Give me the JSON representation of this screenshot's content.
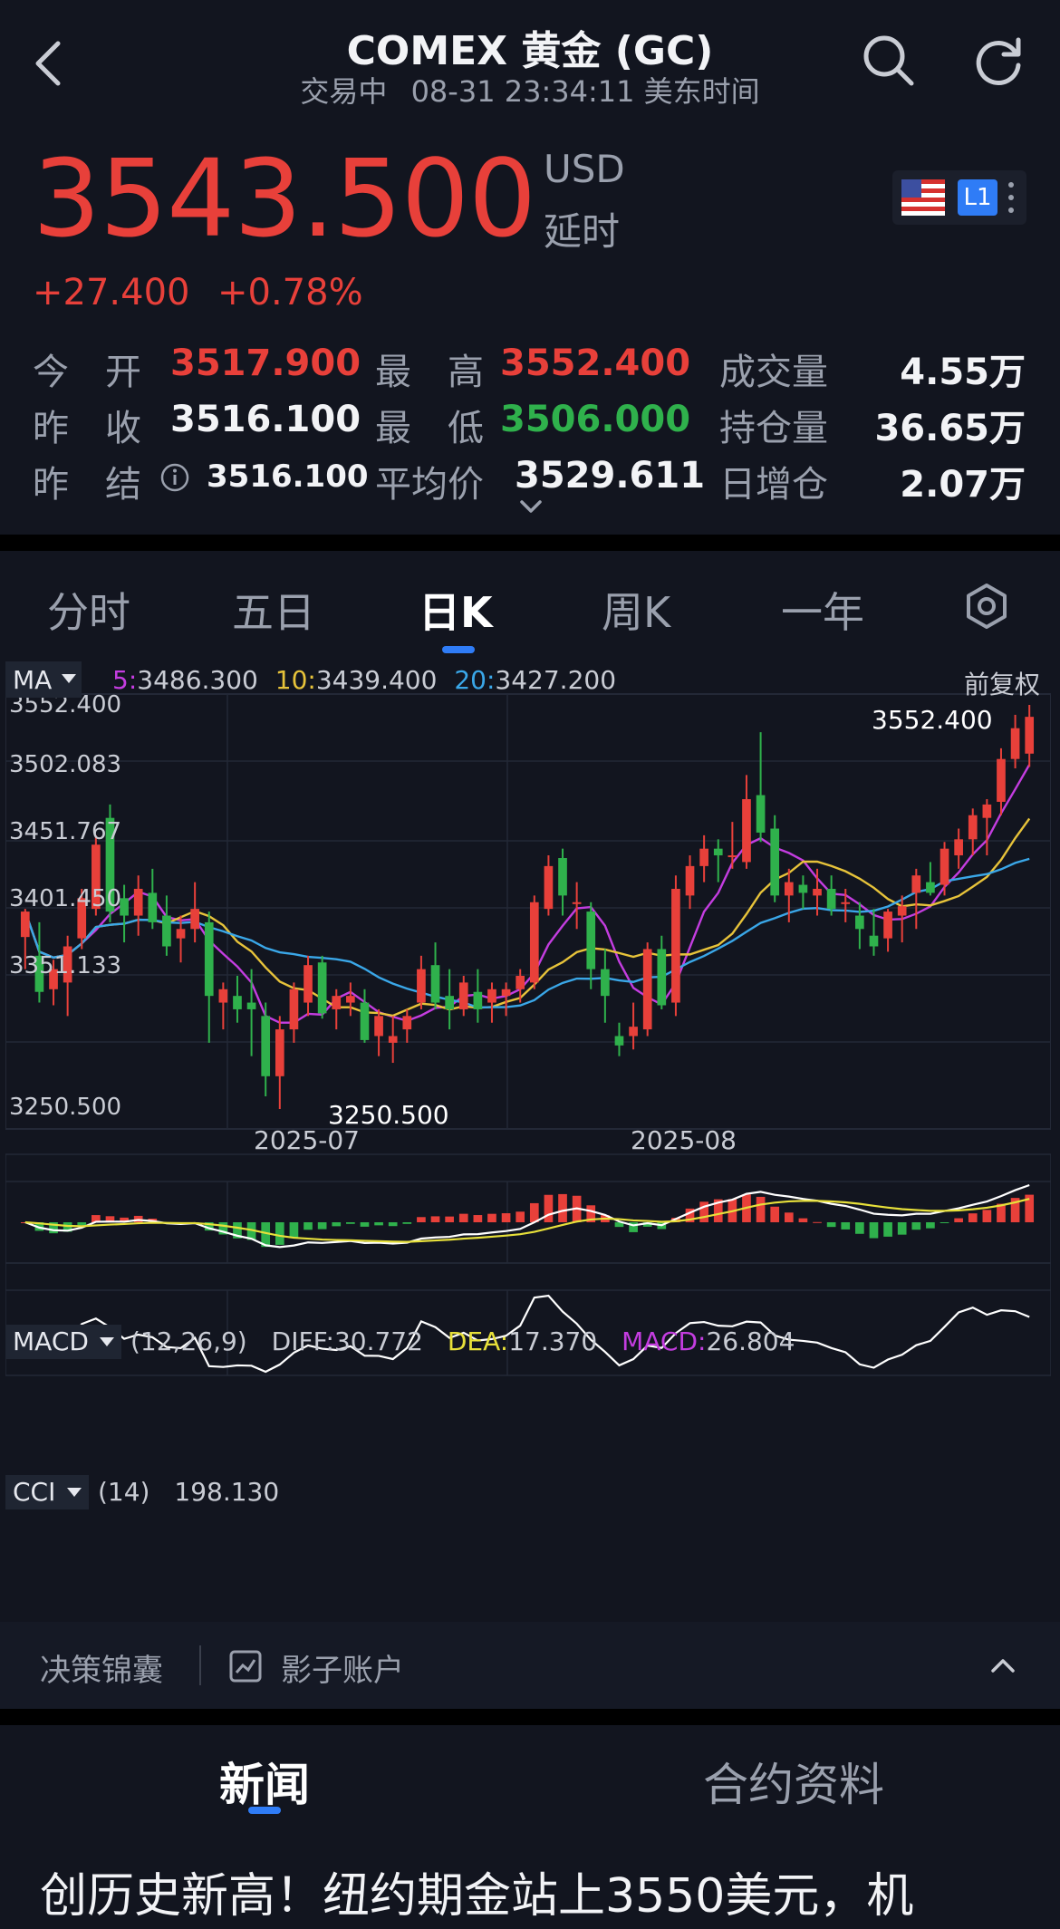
{
  "header": {
    "title": "COMEX 黄金 (GC)",
    "status": "交易中",
    "timestamp": "08-31 23:34:11 美东时间"
  },
  "quote": {
    "price": "3543.500",
    "currency": "USD",
    "delay": "延时",
    "change": "+27.400",
    "change_pct": "+0.78%",
    "level_badge": "L1",
    "up_color": "#e8403a",
    "down_color": "#2fb14c"
  },
  "stats": {
    "open_label": "今　开",
    "open": "3517.900",
    "high_label": "最　高",
    "high": "3552.400",
    "volume_label": "成交量",
    "volume": "4.55万",
    "prev_close_label": "昨　收",
    "prev_close": "3516.100",
    "low_label": "最　低",
    "low": "3506.000",
    "oi_label": "持仓量",
    "oi": "36.65万",
    "prev_settle_label": "昨　结",
    "prev_settle": "3516.100",
    "avg_label": "平均价",
    "avg": "3529.611",
    "oi_chg_label": "日增仓",
    "oi_chg": "2.07万"
  },
  "tabs": [
    "分时",
    "五日",
    "日K",
    "周K",
    "一年"
  ],
  "active_tab": "日K",
  "indicators": {
    "ma_btn": "MA",
    "ma5_key": "5:",
    "ma5": "3486.300",
    "ma10_key": "10:",
    "ma10": "3439.400",
    "ma20_key": "20:",
    "ma20": "3427.200",
    "adjust": "前复权",
    "macd_btn": "MACD",
    "macd_params": "(12,26,9)",
    "diff_key": "DIFF:",
    "diff": "30.772",
    "dea_key": "DEA:",
    "dea": "17.370",
    "macd_key": "MACD:",
    "macd": "26.804",
    "cci_btn": "CCI",
    "cci_params": "(14)",
    "cci": "198.130"
  },
  "chart_data": {
    "type": "candlestick",
    "y_axis_ticks": [
      "3552.400",
      "3502.083",
      "3451.767",
      "3401.450",
      "3351.133",
      "3250.500"
    ],
    "x_axis_ticks": [
      "2025-07",
      "2025-08"
    ],
    "ylim": [
      3250.5,
      3552.4
    ],
    "annotations": {
      "max_label": "3552.400",
      "min_label": "3250.500"
    },
    "candles": [
      {
        "o": 3379,
        "h": 3400,
        "l": 3355,
        "c": 3398
      },
      {
        "o": 3365,
        "h": 3390,
        "l": 3330,
        "c": 3338
      },
      {
        "o": 3340,
        "h": 3362,
        "l": 3328,
        "c": 3355
      },
      {
        "o": 3345,
        "h": 3380,
        "l": 3320,
        "c": 3372
      },
      {
        "o": 3378,
        "h": 3415,
        "l": 3370,
        "c": 3408
      },
      {
        "o": 3400,
        "h": 3455,
        "l": 3395,
        "c": 3448
      },
      {
        "o": 3468,
        "h": 3478,
        "l": 3390,
        "c": 3398
      },
      {
        "o": 3408,
        "h": 3418,
        "l": 3375,
        "c": 3395
      },
      {
        "o": 3395,
        "h": 3425,
        "l": 3380,
        "c": 3415
      },
      {
        "o": 3412,
        "h": 3430,
        "l": 3385,
        "c": 3390
      },
      {
        "o": 3395,
        "h": 3410,
        "l": 3365,
        "c": 3372
      },
      {
        "o": 3378,
        "h": 3395,
        "l": 3360,
        "c": 3385
      },
      {
        "o": 3385,
        "h": 3420,
        "l": 3375,
        "c": 3400
      },
      {
        "o": 3390,
        "h": 3398,
        "l": 3300,
        "c": 3335
      },
      {
        "o": 3330,
        "h": 3345,
        "l": 3310,
        "c": 3340
      },
      {
        "o": 3335,
        "h": 3350,
        "l": 3315,
        "c": 3325
      },
      {
        "o": 3330,
        "h": 3355,
        "l": 3290,
        "c": 3325
      },
      {
        "o": 3320,
        "h": 3330,
        "l": 3260,
        "c": 3275
      },
      {
        "o": 3275,
        "h": 3320,
        "l": 3250.5,
        "c": 3310
      },
      {
        "o": 3310,
        "h": 3345,
        "l": 3300,
        "c": 3340
      },
      {
        "o": 3330,
        "h": 3365,
        "l": 3320,
        "c": 3358
      },
      {
        "o": 3360,
        "h": 3365,
        "l": 3318,
        "c": 3322
      },
      {
        "o": 3325,
        "h": 3340,
        "l": 3310,
        "c": 3335
      },
      {
        "o": 3330,
        "h": 3345,
        "l": 3320,
        "c": 3335
      },
      {
        "o": 3330,
        "h": 3340,
        "l": 3300,
        "c": 3302
      },
      {
        "o": 3305,
        "h": 3325,
        "l": 3290,
        "c": 3320
      },
      {
        "o": 3300,
        "h": 3320,
        "l": 3285,
        "c": 3305
      },
      {
        "o": 3310,
        "h": 3325,
        "l": 3300,
        "c": 3320
      },
      {
        "o": 3330,
        "h": 3365,
        "l": 3325,
        "c": 3355
      },
      {
        "o": 3358,
        "h": 3375,
        "l": 3325,
        "c": 3330
      },
      {
        "o": 3335,
        "h": 3355,
        "l": 3310,
        "c": 3325
      },
      {
        "o": 3325,
        "h": 3350,
        "l": 3320,
        "c": 3345
      },
      {
        "o": 3338,
        "h": 3355,
        "l": 3315,
        "c": 3325
      },
      {
        "o": 3330,
        "h": 3345,
        "l": 3315,
        "c": 3340
      },
      {
        "o": 3335,
        "h": 3345,
        "l": 3320,
        "c": 3340
      },
      {
        "o": 3340,
        "h": 3355,
        "l": 3330,
        "c": 3350
      },
      {
        "o": 3345,
        "h": 3410,
        "l": 3340,
        "c": 3405
      },
      {
        "o": 3400,
        "h": 3440,
        "l": 3395,
        "c": 3432
      },
      {
        "o": 3438,
        "h": 3445,
        "l": 3395,
        "c": 3410
      },
      {
        "o": 3405,
        "h": 3420,
        "l": 3385,
        "c": 3405
      },
      {
        "o": 3398,
        "h": 3405,
        "l": 3340,
        "c": 3355
      },
      {
        "o": 3355,
        "h": 3370,
        "l": 3315,
        "c": 3335
      },
      {
        "o": 3305,
        "h": 3315,
        "l": 3290,
        "c": 3298
      },
      {
        "o": 3305,
        "h": 3330,
        "l": 3295,
        "c": 3312
      },
      {
        "o": 3310,
        "h": 3375,
        "l": 3305,
        "c": 3370
      },
      {
        "o": 3370,
        "h": 3380,
        "l": 3325,
        "c": 3328
      },
      {
        "o": 3330,
        "h": 3425,
        "l": 3320,
        "c": 3415
      },
      {
        "o": 3410,
        "h": 3440,
        "l": 3400,
        "c": 3432
      },
      {
        "o": 3432,
        "h": 3455,
        "l": 3420,
        "c": 3445
      },
      {
        "o": 3445,
        "h": 3452,
        "l": 3420,
        "c": 3440
      },
      {
        "o": 3440,
        "h": 3465,
        "l": 3430,
        "c": 3440
      },
      {
        "o": 3435,
        "h": 3500,
        "l": 3430,
        "c": 3482
      },
      {
        "o": 3485,
        "h": 3532,
        "l": 3450,
        "c": 3457
      },
      {
        "o": 3460,
        "h": 3470,
        "l": 3405,
        "c": 3410
      },
      {
        "o": 3410,
        "h": 3430,
        "l": 3390,
        "c": 3420
      },
      {
        "o": 3418,
        "h": 3425,
        "l": 3400,
        "c": 3412
      },
      {
        "o": 3410,
        "h": 3430,
        "l": 3395,
        "c": 3415
      },
      {
        "o": 3415,
        "h": 3425,
        "l": 3395,
        "c": 3400
      },
      {
        "o": 3405,
        "h": 3415,
        "l": 3390,
        "c": 3405
      },
      {
        "o": 3395,
        "h": 3405,
        "l": 3370,
        "c": 3385
      },
      {
        "o": 3380,
        "h": 3400,
        "l": 3365,
        "c": 3372
      },
      {
        "o": 3378,
        "h": 3400,
        "l": 3368,
        "c": 3398
      },
      {
        "o": 3395,
        "h": 3410,
        "l": 3375,
        "c": 3402
      },
      {
        "o": 3412,
        "h": 3430,
        "l": 3385,
        "c": 3425
      },
      {
        "o": 3420,
        "h": 3435,
        "l": 3410,
        "c": 3412
      },
      {
        "o": 3418,
        "h": 3450,
        "l": 3410,
        "c": 3445
      },
      {
        "o": 3440,
        "h": 3460,
        "l": 3430,
        "c": 3452
      },
      {
        "o": 3452,
        "h": 3475,
        "l": 3440,
        "c": 3470
      },
      {
        "o": 3468,
        "h": 3482,
        "l": 3440,
        "c": 3478
      },
      {
        "o": 3480,
        "h": 3520,
        "l": 3470,
        "c": 3512
      },
      {
        "o": 3512,
        "h": 3545,
        "l": 3505,
        "c": 3535
      },
      {
        "o": 3516,
        "h": 3552.4,
        "l": 3506,
        "c": 3543.5
      }
    ]
  },
  "bottom_bar": {
    "item1": "决策锦囊",
    "item2": "影子账户"
  },
  "news_tabs": [
    "新闻",
    "合约资料"
  ],
  "headline": "创历史新高！纽约期金站上3550美元，机"
}
